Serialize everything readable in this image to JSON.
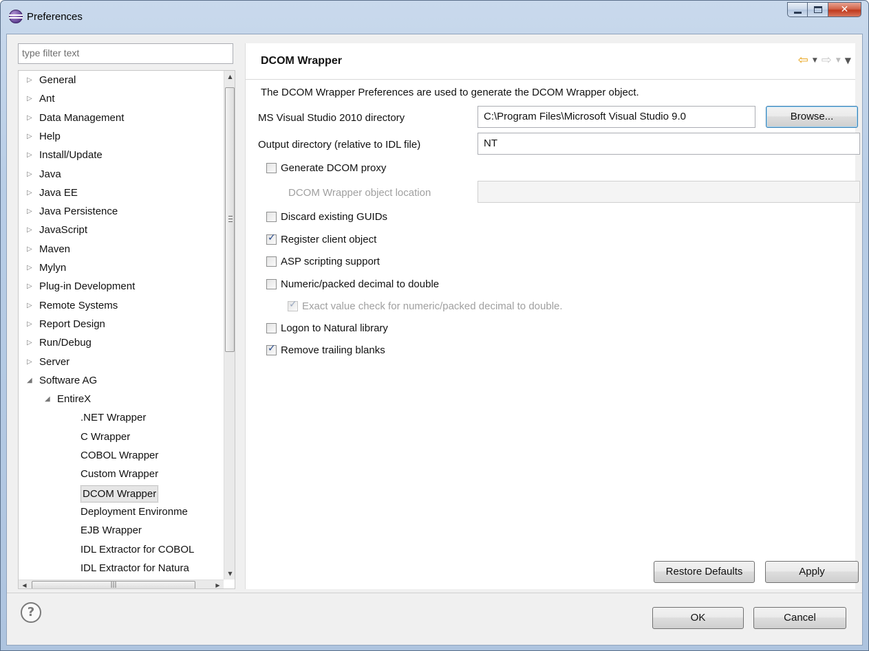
{
  "window": {
    "title": "Preferences"
  },
  "filter": {
    "placeholder": "type filter text"
  },
  "tree": {
    "nodes": [
      {
        "label": "General",
        "level": 0,
        "state": "collapsed"
      },
      {
        "label": "Ant",
        "level": 0,
        "state": "collapsed"
      },
      {
        "label": "Data Management",
        "level": 0,
        "state": "collapsed"
      },
      {
        "label": "Help",
        "level": 0,
        "state": "collapsed"
      },
      {
        "label": "Install/Update",
        "level": 0,
        "state": "collapsed"
      },
      {
        "label": "Java",
        "level": 0,
        "state": "collapsed"
      },
      {
        "label": "Java EE",
        "level": 0,
        "state": "collapsed"
      },
      {
        "label": "Java Persistence",
        "level": 0,
        "state": "collapsed"
      },
      {
        "label": "JavaScript",
        "level": 0,
        "state": "collapsed"
      },
      {
        "label": "Maven",
        "level": 0,
        "state": "collapsed"
      },
      {
        "label": "Mylyn",
        "level": 0,
        "state": "collapsed"
      },
      {
        "label": "Plug-in Development",
        "level": 0,
        "state": "collapsed"
      },
      {
        "label": "Remote Systems",
        "level": 0,
        "state": "collapsed"
      },
      {
        "label": "Report Design",
        "level": 0,
        "state": "collapsed"
      },
      {
        "label": "Run/Debug",
        "level": 0,
        "state": "collapsed"
      },
      {
        "label": "Server",
        "level": 0,
        "state": "collapsed"
      },
      {
        "label": "Software AG",
        "level": 0,
        "state": "expanded"
      },
      {
        "label": "EntireX",
        "level": 1,
        "state": "expanded"
      },
      {
        "label": ".NET Wrapper",
        "level": 2,
        "state": "leaf"
      },
      {
        "label": "C Wrapper",
        "level": 2,
        "state": "leaf"
      },
      {
        "label": "COBOL Wrapper",
        "level": 2,
        "state": "leaf"
      },
      {
        "label": "Custom Wrapper",
        "level": 2,
        "state": "leaf"
      },
      {
        "label": "DCOM Wrapper",
        "level": 2,
        "state": "leaf",
        "selected": true
      },
      {
        "label": "Deployment Environme",
        "level": 2,
        "state": "leaf"
      },
      {
        "label": "EJB Wrapper",
        "level": 2,
        "state": "leaf"
      },
      {
        "label": "IDL Extractor for COBOL",
        "level": 2,
        "state": "leaf"
      },
      {
        "label": "IDL Extractor for Natura",
        "level": 2,
        "state": "leaf"
      }
    ]
  },
  "page": {
    "title": "DCOM Wrapper",
    "description": "The DCOM Wrapper Preferences are used to generate the DCOM Wrapper object.",
    "vs_dir": {
      "label": "MS Visual Studio 2010 directory",
      "value": "C:\\Program Files\\Microsoft Visual Studio 9.0",
      "browse_label": "Browse..."
    },
    "output_dir": {
      "label": "Output directory (relative to IDL file)",
      "value": "NT"
    },
    "options": [
      {
        "key": "gen_proxy",
        "label": "Generate DCOM proxy",
        "checked": false,
        "enabled": true
      },
      {
        "key": "discard_guids",
        "label": "Discard existing GUIDs",
        "checked": false,
        "enabled": true
      },
      {
        "key": "register_client",
        "label": "Register client object",
        "checked": true,
        "enabled": true
      },
      {
        "key": "asp_scripting",
        "label": "ASP scripting support",
        "checked": false,
        "enabled": true
      },
      {
        "key": "numeric_packed",
        "label": "Numeric/packed decimal to double",
        "checked": false,
        "enabled": true
      },
      {
        "key": "exact_value",
        "label": "Exact value check for numeric/packed decimal to double.",
        "checked": true,
        "enabled": false
      },
      {
        "key": "logon_natural",
        "label": "Logon to Natural library",
        "checked": false,
        "enabled": true
      },
      {
        "key": "remove_trailing",
        "label": "Remove trailing blanks",
        "checked": true,
        "enabled": true
      }
    ],
    "object_location": {
      "label": "DCOM Wrapper object location",
      "value": ""
    },
    "restore_label": "Restore Defaults",
    "apply_label": "Apply"
  },
  "footer": {
    "ok_label": "OK",
    "cancel_label": "Cancel",
    "help_glyph": "?"
  },
  "colors": {
    "accent": "#3c7fb1",
    "back_arrow": "#e8a318",
    "disabled_text": "#a0a0a0"
  },
  "icons": [
    "eclipse-app-icon",
    "minimize-icon",
    "maximize-icon",
    "close-icon",
    "back-arrow-icon",
    "forward-arrow-icon",
    "help-icon"
  ]
}
